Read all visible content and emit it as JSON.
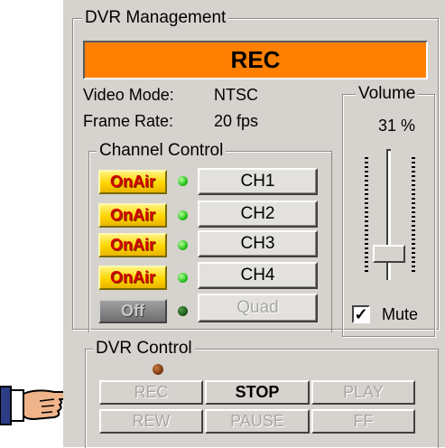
{
  "dvr_management": {
    "title": "DVR Management",
    "status": "REC",
    "status_color": "#ff7f00",
    "video_mode_label": "Video Mode:",
    "video_mode_value": "NTSC",
    "frame_rate_label": "Frame Rate:",
    "frame_rate_value": "20 fps"
  },
  "channel_control": {
    "title": "Channel Control",
    "rows": [
      {
        "onair": "OnAir",
        "channel": "CH1"
      },
      {
        "onair": "OnAir",
        "channel": "CH2"
      },
      {
        "onair": "OnAir",
        "channel": "CH3"
      },
      {
        "onair": "OnAir",
        "channel": "CH4"
      },
      {
        "onair": "Off",
        "channel": "Quad"
      }
    ]
  },
  "volume": {
    "title": "Volume",
    "value_text": "31 %",
    "level": 0.31,
    "mute_label": "Mute",
    "mute_checked": true
  },
  "dvr_control": {
    "title": "DVR Control",
    "buttons": {
      "rec": "REC",
      "stop": "STOP",
      "play": "PLAY",
      "rew": "REW",
      "pause": "PAUSE",
      "ff": "FF"
    }
  }
}
